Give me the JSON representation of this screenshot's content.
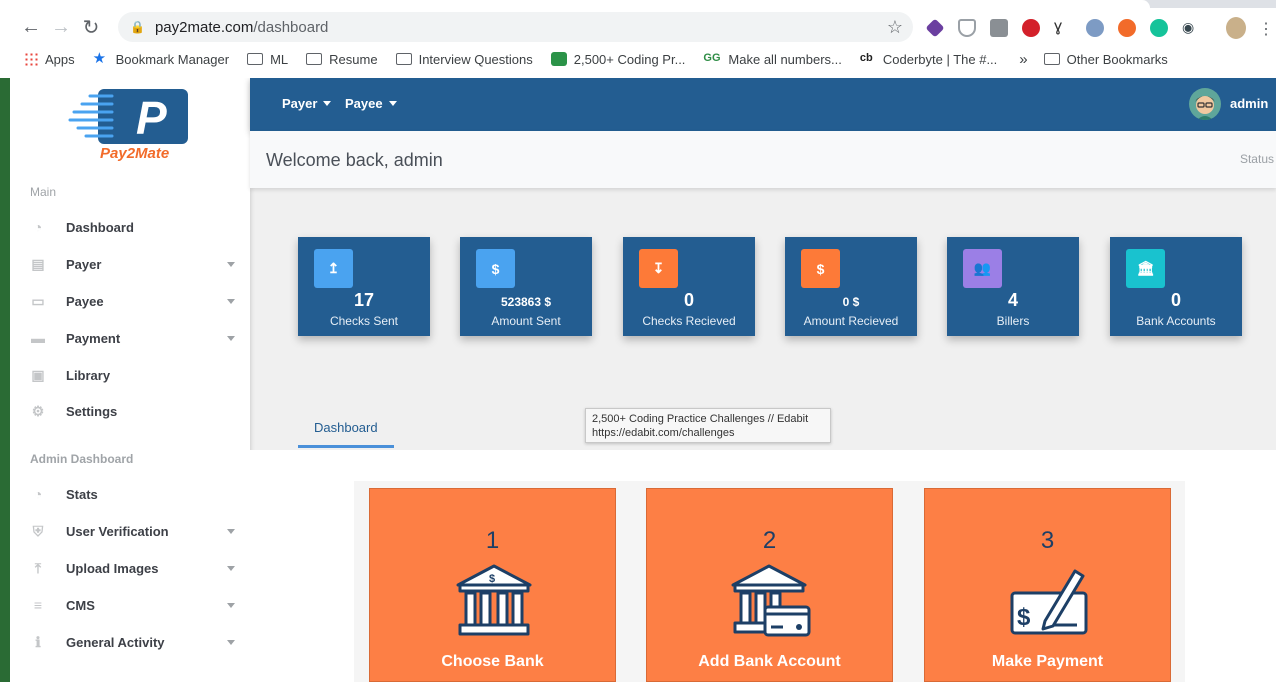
{
  "browser": {
    "url_domain": "pay2mate.com",
    "url_path": "/dashboard",
    "bookmarks": [
      "Apps",
      "Bookmark Manager",
      "ML",
      "Resume",
      "Interview Questions",
      "2,500+ Coding Pr...",
      "Make all numbers...",
      "Coderbyte | The #..."
    ],
    "overflow": "»",
    "other_bookmarks": "Other Bookmarks"
  },
  "sidebar": {
    "logo_text": "Pay2Mate",
    "main_title": "Main",
    "main_items": [
      {
        "label": "Dashboard",
        "icon": "dashboard-icon"
      },
      {
        "label": "Payer",
        "icon": "payer-icon"
      },
      {
        "label": "Payee",
        "icon": "payee-icon"
      },
      {
        "label": "Payment",
        "icon": "payment-icon"
      },
      {
        "label": "Library",
        "icon": "library-icon"
      },
      {
        "label": "Settings",
        "icon": "gear-icon"
      }
    ],
    "admin_title": "Admin Dashboard",
    "admin_items": [
      {
        "label": "Stats",
        "icon": "stats-icon"
      },
      {
        "label": "User Verification",
        "icon": "shield-icon"
      },
      {
        "label": "Upload Images",
        "icon": "upload-icon"
      },
      {
        "label": "CMS",
        "icon": "cms-icon"
      },
      {
        "label": "General Activity",
        "icon": "info-icon"
      }
    ]
  },
  "topbar": {
    "menu_payer": "Payer",
    "menu_payee": "Payee",
    "username": "admin"
  },
  "welcome": {
    "title": "Welcome back, admin",
    "status": "Status"
  },
  "stats": [
    {
      "value": "17",
      "label": "Checks Sent",
      "color": "#4aa3f0",
      "glyph": "↥"
    },
    {
      "value": "523863 $",
      "label": "Amount Sent",
      "color": "#4aa3f0",
      "glyph": "$"
    },
    {
      "value": "0",
      "label": "Checks Recieved",
      "color": "#fd7a38",
      "glyph": "↧"
    },
    {
      "value": "0 $",
      "label": "Amount Recieved",
      "color": "#fd7a38",
      "glyph": "$"
    },
    {
      "value": "4",
      "label": "Billers",
      "color": "#9b7fe6",
      "glyph": "👥"
    },
    {
      "value": "0",
      "label": "Bank Accounts",
      "color": "#19c2cf",
      "glyph": "🏛"
    }
  ],
  "tabs": {
    "dashboard": "Dashboard"
  },
  "tooltip": {
    "title": "2,500+ Coding Practice Challenges // Edabit",
    "url": "https://edabit.com/challenges"
  },
  "steps": [
    {
      "number": "1",
      "label": "Choose Bank"
    },
    {
      "number": "2",
      "label": "Add Bank Account"
    },
    {
      "number": "3",
      "label": "Make Payment"
    }
  ]
}
